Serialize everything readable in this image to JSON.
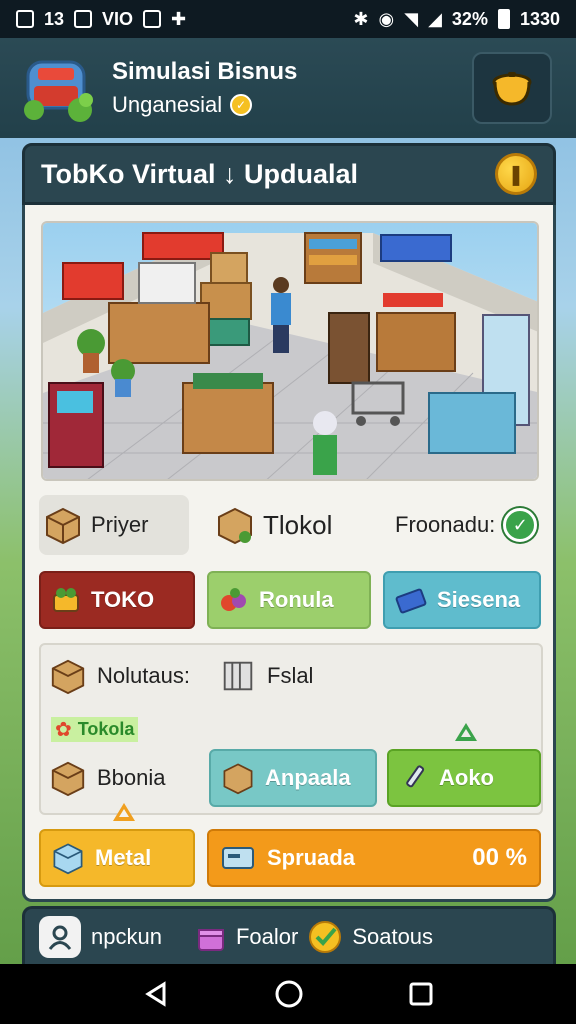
{
  "status": {
    "left_time": "13",
    "left_carrier": "VIO",
    "battery_pct": "32%",
    "clock": "1330"
  },
  "header": {
    "title": "Simulasi Bisnus",
    "subtitle": "Unganesial"
  },
  "panel": {
    "title": "TobKo Virtual ↓ Updualal"
  },
  "stats": [
    {
      "label": "Priyer"
    },
    {
      "label": "Tlokol"
    },
    {
      "label": "Froonadu:"
    }
  ],
  "buttons": {
    "toko": "TOKO",
    "ronula": "Ronula",
    "siesena": "Siesena",
    "anpaala": "Anpaala",
    "aoko": "Aoko",
    "metal": "Metal"
  },
  "items": {
    "nolutaus": "Nolutaus:",
    "fslal": "Fslal",
    "tokola": "Tokola",
    "bbonia": "Bbonia"
  },
  "progress": {
    "label": "Spruada",
    "value_text": "00 %"
  },
  "bottom": {
    "profile": "npckun",
    "foalor": "Foalor",
    "soatous": "Soatous"
  },
  "colors": {
    "toko": "#9b2a22",
    "ronula": "#9ccf6c",
    "siesena": "#5fbccd",
    "anpaala": "#78c8c6",
    "aoko": "#7cc440",
    "metal": "#f5b82a",
    "progress": "#f39a1a",
    "frame": "#2b4650"
  }
}
